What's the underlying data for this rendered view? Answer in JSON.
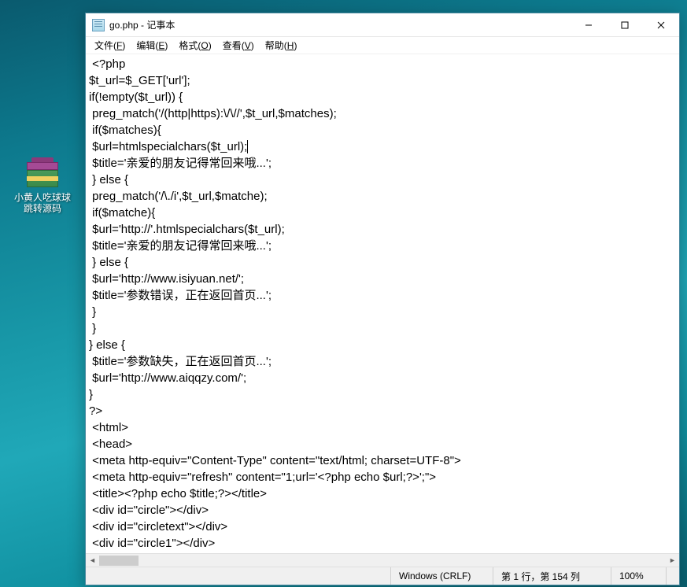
{
  "desktop": {
    "icon_name": "rar-archive-icon",
    "label_line1": "小黄人吃球球",
    "label_line2": "跳转源码"
  },
  "window": {
    "title": "go.php - 记事本",
    "buttons": {
      "minimize": "minimize",
      "maximize": "maximize",
      "close": "close"
    }
  },
  "menu": {
    "file": {
      "label": "文件",
      "accel": "F"
    },
    "edit": {
      "label": "编辑",
      "accel": "E"
    },
    "format": {
      "label": "格式",
      "accel": "O"
    },
    "view": {
      "label": "查看",
      "accel": "V"
    },
    "help": {
      "label": "帮助",
      "accel": "H"
    }
  },
  "editor": {
    "lines": [
      " <?php",
      "$t_url=$_GET['url'];",
      "if(!empty($t_url)) {",
      " preg_match('/(http|https):\\/\\//',$t_url,$matches);",
      " if($matches){",
      " $url=htmlspecialchars($t_url);",
      " $title='亲爱的朋友记得常回来哦...';",
      " } else {",
      " preg_match('/\\./i',$t_url,$matche);",
      " if($matche){",
      " $url='http://'.htmlspecialchars($t_url);",
      " $title='亲爱的朋友记得常回来哦...';",
      " } else {",
      " $url='http://www.isiyuan.net/';",
      " $title='参数错误，正在返回首页...';",
      " }",
      " }",
      "} else {",
      " $title='参数缺失，正在返回首页...';",
      " $url='http://www.aiqqzy.com/';",
      "}",
      "?>",
      " <html>",
      " <head>",
      " <meta http-equiv=\"Content-Type\" content=\"text/html; charset=UTF-8\">",
      " <meta http-equiv=\"refresh\" content=\"1;url='<?php echo $url;?>';\">",
      " <title><?php echo $title;?></title>",
      " <div id=\"circle\"></div>",
      " <div id=\"circletext\"></div>",
      " <div id=\"circle1\"></div>"
    ],
    "caret_line_index": 5
  },
  "statusbar": {
    "encoding": "Windows (CRLF)",
    "position": "第 1 行，第 154 列",
    "zoom": "100%"
  }
}
